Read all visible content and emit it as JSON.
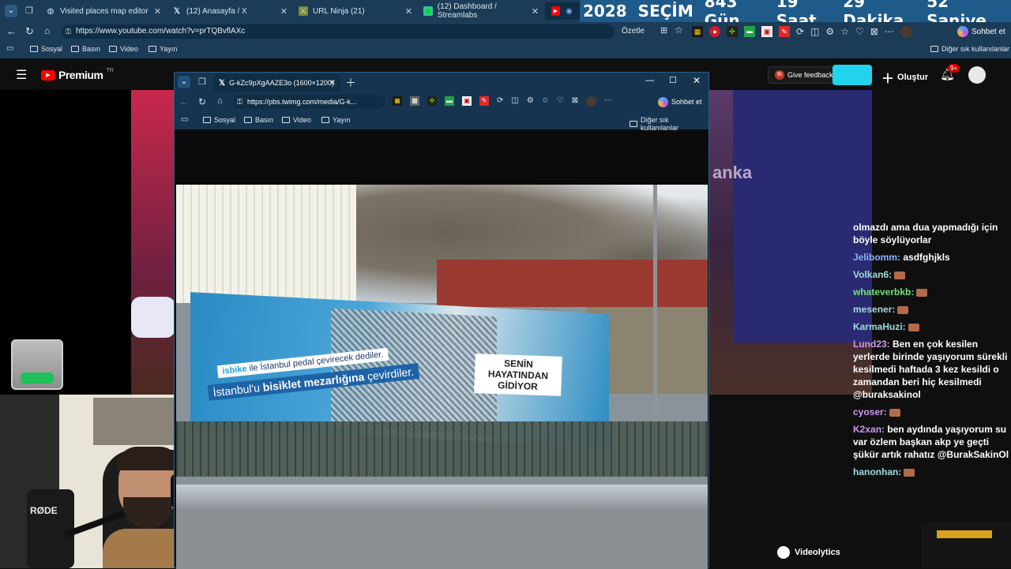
{
  "tabs": [
    {
      "title": "Visited places map editor"
    },
    {
      "title": "(12) Anasayfa / X"
    },
    {
      "title": "URL Ninja (21)"
    },
    {
      "title": "(12) Dashboard / Streamlabs"
    }
  ],
  "countdown": {
    "year": "2028",
    "label": "SEÇİM",
    "days": "843 Gün",
    "hours": "19 Saat",
    "minutes": "29 Dakika",
    "seconds": "52 Saniye"
  },
  "address_bar": {
    "url": "https://www.youtube.com/watch?v=prTQBvflAXc",
    "summarize": "Özetle",
    "chat": "Sohbet et"
  },
  "bookmarks": [
    "Sosyal",
    "Basın",
    "Video",
    "Yayın"
  ],
  "bookmarks_other": "Diğer sık kullanılanlar",
  "youtube": {
    "logo": "Premium",
    "logo_sup": "TR",
    "feedback": "Give feedback",
    "create": "Oluştur",
    "notif_count": "9+"
  },
  "stream_overlay": {
    "channel_watermark": "anka"
  },
  "chat": {
    "messages": [
      {
        "name": "",
        "text": "olmazdı ama dua yapmadığı için böyle söylüyorlar",
        "cls": ""
      },
      {
        "name": "Jelibomm:",
        "text": "asdfghjkls",
        "cls": "b"
      },
      {
        "name": "Volkan6:",
        "text": "",
        "cls": "t"
      },
      {
        "name": "whateverbkb:",
        "text": "",
        "cls": "g"
      },
      {
        "name": "mesener:",
        "text": "",
        "cls": "t"
      },
      {
        "name": "KarmaHuzi:",
        "text": "",
        "cls": "t"
      },
      {
        "name": "Lund23:",
        "text": "Ben en çok kesilen yerlerde birinde yaşıyorum sürekli kesilmedi haftada 3 kez kesildi o zamandan beri hiç kesilmedi @buraksakinol",
        "cls": "p"
      },
      {
        "name": "cyoser:",
        "text": "",
        "cls": "p"
      },
      {
        "name": "K2xan:",
        "text": "ben aydında yaşıyorum su var özlem başkan akp ye geçti şükür artık rahatız @BurakSakinOl",
        "cls": "p"
      },
      {
        "name": "hanonhan:",
        "text": "",
        "cls": "t"
      }
    ]
  },
  "popup": {
    "tab_title": "G-kZc9pXgAAZE3o (1600×1200)",
    "url": "https://pbs.twimg.com/media/G-k...",
    "chat": "Sohbet et",
    "bookmarks": [
      "Sosyal",
      "Basın",
      "Video",
      "Yayın"
    ],
    "bookmarks_other": "Diğer sık kullanılanlar"
  },
  "billboard": {
    "line1_brand": "isbike",
    "line1": "ile İstanbul pedal çevirecek dediler.",
    "line2_a": "İstanbul'u",
    "line2_b": "bisiklet mezarlığına",
    "line2_c": "çevirdiler.",
    "right1": "SENİN HAYATINDAN",
    "right2": "GİDİYOR"
  },
  "webcam": {
    "mic_brand": "RØDE"
  },
  "videolytics": "Videolytics",
  "colors": {
    "youtube_red": "#ff0000",
    "chrome_blue": "#1b3b57",
    "accent_cyan": "#22d3ee"
  }
}
